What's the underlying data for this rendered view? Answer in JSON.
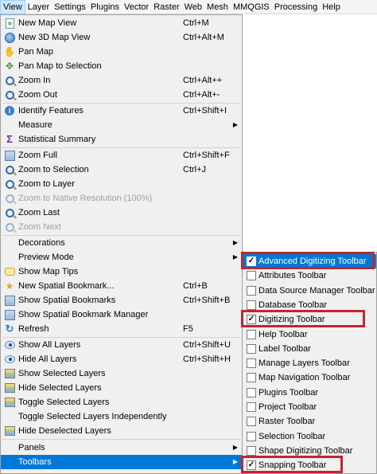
{
  "menubar": {
    "items": [
      "View",
      "Layer",
      "Settings",
      "Plugins",
      "Vector",
      "Raster",
      "Web",
      "Mesh",
      "MMQGIS",
      "Processing",
      "Help"
    ],
    "active": "View"
  },
  "view_menu": {
    "new_map_view": {
      "label": "New Map View",
      "shortcut": "Ctrl+M"
    },
    "new_3d_map_view": {
      "label": "New 3D Map View",
      "shortcut": "Ctrl+Alt+M"
    },
    "pan_map": {
      "label": "Pan Map"
    },
    "pan_map_to_selection": {
      "label": "Pan Map to Selection"
    },
    "zoom_in": {
      "label": "Zoom In",
      "shortcut": "Ctrl+Alt++"
    },
    "zoom_out": {
      "label": "Zoom Out",
      "shortcut": "Ctrl+Alt+-"
    },
    "identify_features": {
      "label": "Identify Features",
      "shortcut": "Ctrl+Shift+I"
    },
    "measure": {
      "label": "Measure"
    },
    "statistical_summary": {
      "label": "Statistical Summary"
    },
    "zoom_full": {
      "label": "Zoom Full",
      "shortcut": "Ctrl+Shift+F"
    },
    "zoom_to_selection": {
      "label": "Zoom to Selection",
      "shortcut": "Ctrl+J"
    },
    "zoom_to_layer": {
      "label": "Zoom to Layer"
    },
    "zoom_native": {
      "label": "Zoom to Native Resolution (100%)"
    },
    "zoom_last": {
      "label": "Zoom Last"
    },
    "zoom_next": {
      "label": "Zoom Next"
    },
    "decorations": {
      "label": "Decorations"
    },
    "preview_mode": {
      "label": "Preview Mode"
    },
    "show_map_tips": {
      "label": "Show Map Tips"
    },
    "new_spatial_bookmark": {
      "label": "New Spatial Bookmark...",
      "shortcut": "Ctrl+B"
    },
    "show_spatial_bookmarks": {
      "label": "Show Spatial Bookmarks",
      "shortcut": "Ctrl+Shift+B"
    },
    "show_bookmark_manager": {
      "label": "Show Spatial Bookmark Manager"
    },
    "refresh": {
      "label": "Refresh",
      "shortcut": "F5"
    },
    "show_all_layers": {
      "label": "Show All Layers",
      "shortcut": "Ctrl+Shift+U"
    },
    "hide_all_layers": {
      "label": "Hide All Layers",
      "shortcut": "Ctrl+Shift+H"
    },
    "show_selected_layers": {
      "label": "Show Selected Layers"
    },
    "hide_selected_layers": {
      "label": "Hide Selected Layers"
    },
    "toggle_selected_layers": {
      "label": "Toggle Selected Layers"
    },
    "toggle_selected_independently": {
      "label": "Toggle Selected Layers Independently"
    },
    "hide_deselected_layers": {
      "label": "Hide Deselected Layers"
    },
    "panels": {
      "label": "Panels"
    },
    "toolbars": {
      "label": "Toolbars"
    }
  },
  "toolbars_submenu": [
    {
      "label": "Advanced Digitizing Toolbar",
      "checked": true
    },
    {
      "label": "Attributes Toolbar",
      "checked": false
    },
    {
      "label": "Data Source Manager Toolbar",
      "checked": false
    },
    {
      "label": "Database Toolbar",
      "checked": false
    },
    {
      "label": "Digitizing Toolbar",
      "checked": true
    },
    {
      "label": "Help Toolbar",
      "checked": false
    },
    {
      "label": "Label Toolbar",
      "checked": false
    },
    {
      "label": "Manage Layers Toolbar",
      "checked": false
    },
    {
      "label": "Map Navigation Toolbar",
      "checked": false
    },
    {
      "label": "Plugins Toolbar",
      "checked": false
    },
    {
      "label": "Project Toolbar",
      "checked": false
    },
    {
      "label": "Raster Toolbar",
      "checked": false
    },
    {
      "label": "Selection Toolbar",
      "checked": false
    },
    {
      "label": "Shape Digitizing Toolbar",
      "checked": false
    },
    {
      "label": "Snapping Toolbar",
      "checked": true
    }
  ],
  "colors": {
    "highlight": "#0078d7",
    "annotation": "#c0272d"
  }
}
